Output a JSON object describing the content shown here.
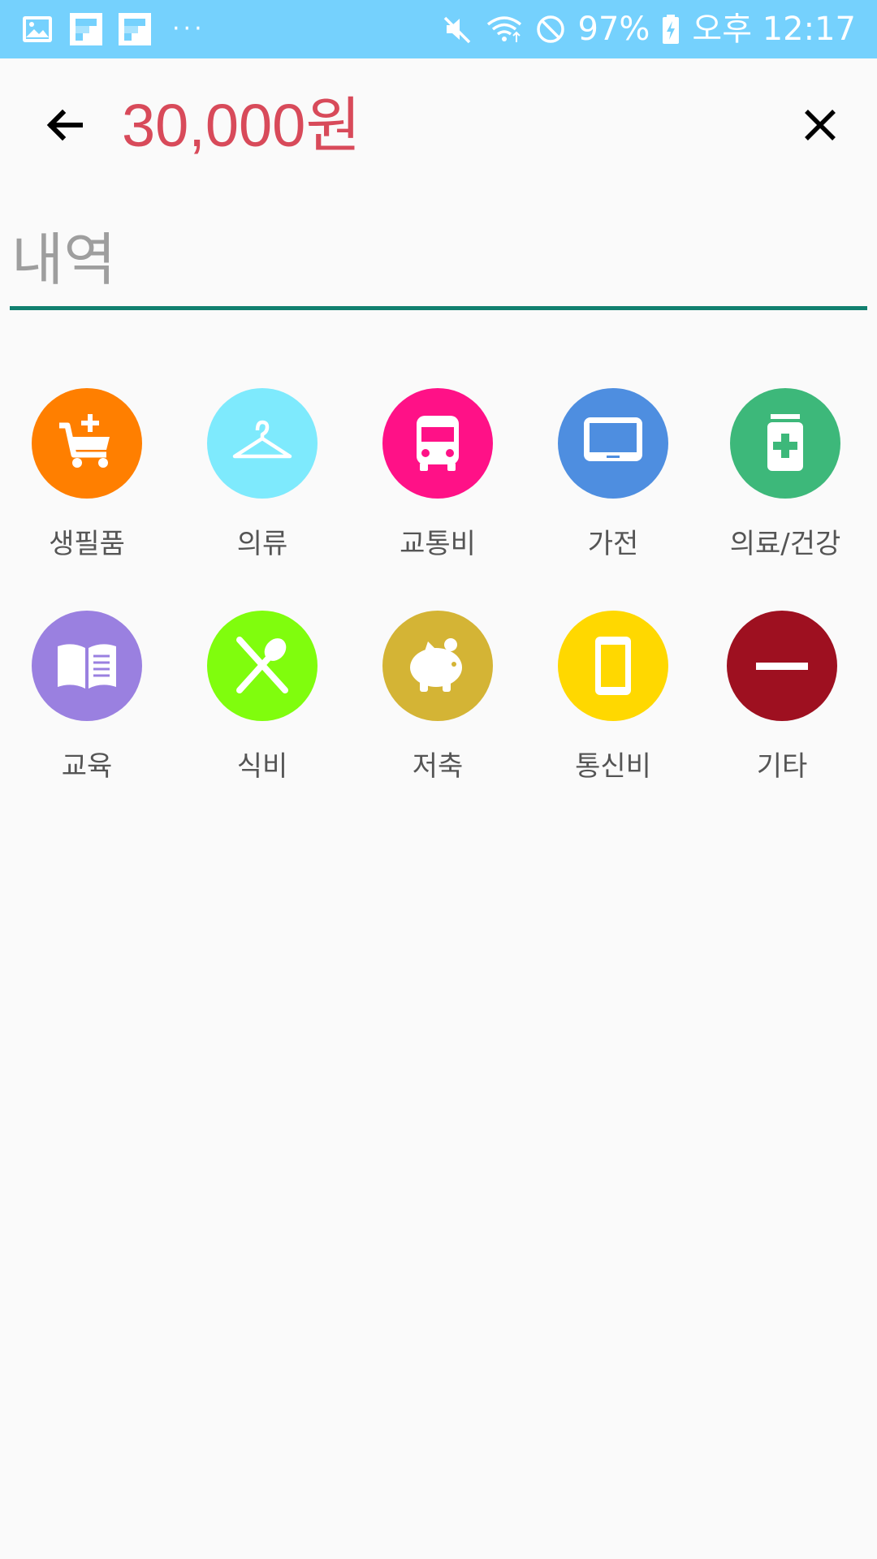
{
  "status_bar": {
    "battery": "97%",
    "time": "오후 12:17",
    "more": "···"
  },
  "toolbar": {
    "amount": "30,000원"
  },
  "memo": {
    "placeholder": "내역",
    "value": ""
  },
  "categories": [
    {
      "label": "생필품",
      "color": "#ff7f00",
      "icon": "shopping-cart-icon"
    },
    {
      "label": "의류",
      "color": "#7eeafd",
      "icon": "hanger-icon"
    },
    {
      "label": "교통비",
      "color": "#ff1187",
      "icon": "bus-icon"
    },
    {
      "label": "가전",
      "color": "#4e8ee0",
      "icon": "monitor-icon"
    },
    {
      "label": "의료/건강",
      "color": "#3db87a",
      "icon": "medicine-icon"
    },
    {
      "label": "교육",
      "color": "#9a80e0",
      "icon": "book-icon"
    },
    {
      "label": "식비",
      "color": "#80fd0d",
      "icon": "utensils-icon"
    },
    {
      "label": "저축",
      "color": "#d4b435",
      "icon": "piggy-bank-icon"
    },
    {
      "label": "통신비",
      "color": "#ffd800",
      "icon": "phone-icon"
    },
    {
      "label": "기타",
      "color": "#9e1020",
      "icon": "minus-icon"
    }
  ]
}
